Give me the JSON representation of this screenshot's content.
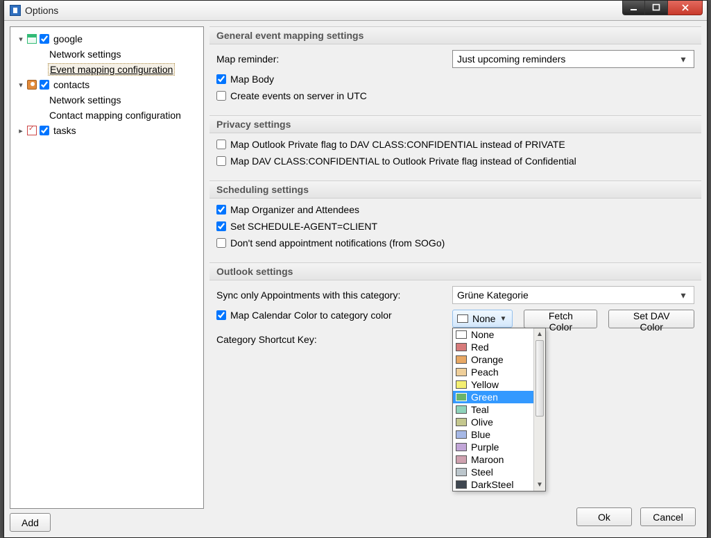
{
  "window": {
    "title": "Options"
  },
  "tree": {
    "nodes": [
      {
        "label": "google",
        "depth": 0,
        "expander": "▾",
        "hasCheckbox": true,
        "kind": "calendar",
        "selected": false
      },
      {
        "label": "Network settings",
        "depth": 1,
        "expander": "",
        "hasCheckbox": false,
        "kind": "",
        "selected": false
      },
      {
        "label": "Event mapping configuration",
        "depth": 1,
        "expander": "",
        "hasCheckbox": false,
        "kind": "",
        "selected": true
      },
      {
        "label": "contacts",
        "depth": 0,
        "expander": "▾",
        "hasCheckbox": true,
        "kind": "contacts",
        "selected": false
      },
      {
        "label": "Network settings",
        "depth": 1,
        "expander": "",
        "hasCheckbox": false,
        "kind": "",
        "selected": false
      },
      {
        "label": "Contact mapping configuration",
        "depth": 1,
        "expander": "",
        "hasCheckbox": false,
        "kind": "",
        "selected": false
      },
      {
        "label": "tasks",
        "depth": 0,
        "expander": "▸",
        "hasCheckbox": true,
        "kind": "tasks",
        "selected": false
      }
    ]
  },
  "buttons": {
    "add": "Add",
    "ok": "Ok",
    "cancel": "Cancel",
    "fetch_color": "Fetch Color",
    "set_dav_color": "Set DAV Color"
  },
  "sections": {
    "general": {
      "header": "General event mapping settings",
      "map_reminder_label": "Map reminder:",
      "map_reminder_value": "Just upcoming reminders",
      "map_body": "Map Body",
      "create_utc": "Create events on server in UTC"
    },
    "privacy": {
      "header": "Privacy settings",
      "opt1": "Map Outlook Private flag to DAV CLASS:CONFIDENTIAL instead of PRIVATE",
      "opt2": "Map DAV CLASS:CONFIDENTIAL to Outlook Private flag instead of Confidential"
    },
    "scheduling": {
      "header": "Scheduling settings",
      "opt1": "Map Organizer and Attendees",
      "opt2": "Set SCHEDULE-AGENT=CLIENT",
      "opt3": "Don't send appointment notifications (from SOGo)"
    },
    "outlook": {
      "header": "Outlook settings",
      "sync_label": "Sync only Appointments with this category:",
      "sync_value": "Grüne Kategorie",
      "map_cal_color": "Map Calendar Color to category color",
      "color_btn": "None",
      "shortcut_label": "Category Shortcut Key:"
    }
  },
  "color_dropdown": {
    "selected": "Green",
    "items": [
      {
        "label": "None",
        "color": "#ffffff"
      },
      {
        "label": "Red",
        "color": "#d77a7a"
      },
      {
        "label": "Orange",
        "color": "#e8a864"
      },
      {
        "label": "Peach",
        "color": "#efcf9a"
      },
      {
        "label": "Yellow",
        "color": "#f4ef71"
      },
      {
        "label": "Green",
        "color": "#6ab46a"
      },
      {
        "label": "Teal",
        "color": "#8fd3bb"
      },
      {
        "label": "Olive",
        "color": "#c4c78e"
      },
      {
        "label": "Blue",
        "color": "#a6b8e6"
      },
      {
        "label": "Purple",
        "color": "#c2a6d8"
      },
      {
        "label": "Maroon",
        "color": "#cfa2b0"
      },
      {
        "label": "Steel",
        "color": "#bcc6cc"
      },
      {
        "label": "DarkSteel",
        "color": "#3f4750"
      }
    ]
  }
}
